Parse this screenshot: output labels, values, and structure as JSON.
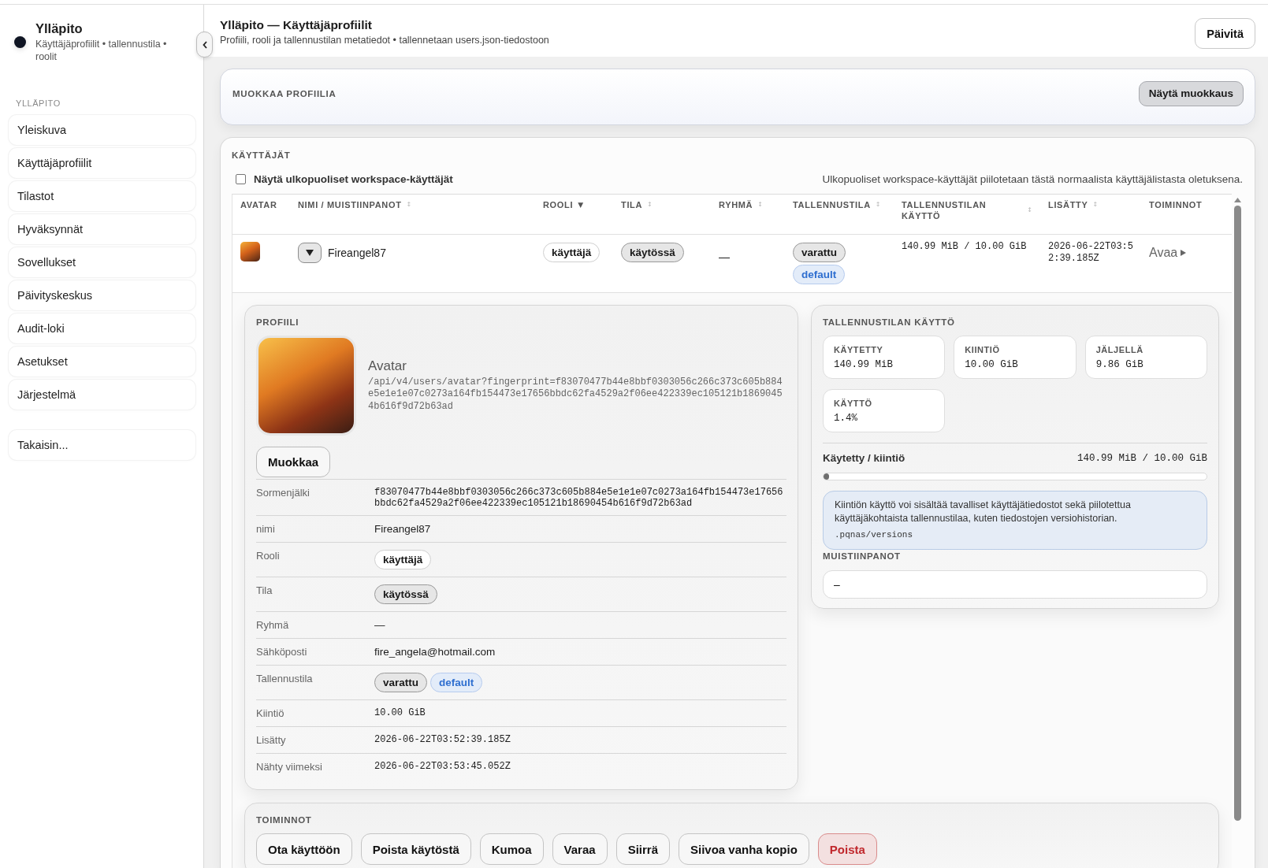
{
  "sidebar": {
    "brand": {
      "title": "Ylläpito",
      "subtitle": "Käyttäjäprofiilit • tallennustila • roolit"
    },
    "section_label": "YLLÄPITO",
    "items": [
      {
        "label": "Yleiskuva",
        "selected": false
      },
      {
        "label": "Käyttäjäprofiilit",
        "selected": false
      },
      {
        "label": "Tilastot",
        "selected": false
      },
      {
        "label": "Hyväksynnät",
        "selected": false
      },
      {
        "label": "Sovellukset",
        "selected": false
      },
      {
        "label": "Päivityskeskus",
        "selected": false
      },
      {
        "label": "Audit-loki",
        "selected": false
      },
      {
        "label": "Asetukset",
        "selected": false
      },
      {
        "label": "Järjestelmä",
        "selected": false
      }
    ],
    "back_item": {
      "label": "Takaisin..."
    }
  },
  "header": {
    "title": "Ylläpito — Käyttäjäprofiilit",
    "subtitle": "Profiili, rooli ja tallennustilan metatiedot • tallennetaan users.json-tiedostoon",
    "refresh_button": "Päivitä"
  },
  "edit_card": {
    "title": "MUOKKAA PROFIILIA",
    "toggle_button": "Näytä muokkaus"
  },
  "users": {
    "title": "KÄYTTÄJÄT",
    "external_filter": {
      "label": "Näytä ulkopuoliset workspace-käyttäjät",
      "checked": false
    },
    "note": "Ulkopuoliset workspace-käyttäjät piilotetaan tästä normaalista käyttäjälistasta oletuksena.",
    "table": {
      "columns": [
        {
          "label": "AVATAR"
        },
        {
          "label": "NIMI / MUISTIINPANOT",
          "sort_mark": "↕",
          "sorted": false
        },
        {
          "label": "ROOLI",
          "sort_mark": "▼",
          "sorted": true
        },
        {
          "label": "TILA",
          "sort_mark": "↕",
          "sorted": false
        },
        {
          "label": "RYHMÄ",
          "sort_mark": "↕",
          "sorted": false
        },
        {
          "label": "TALLENNUSTILA",
          "sort_mark": "↕",
          "sorted": false
        },
        {
          "label": "TALLENNUSTILAN KÄYTTÖ",
          "sort_mark": "↕",
          "sorted": false
        },
        {
          "label": "LISÄTTY",
          "sort_mark": "↕",
          "sorted": false
        },
        {
          "label": "TOIMINNOT"
        }
      ],
      "rows": [
        {
          "name": "Fireangel87",
          "expanded": true,
          "role": {
            "label": "käyttäjä",
            "kind": "outline"
          },
          "status": {
            "label": "käytössä",
            "kind": "neutral"
          },
          "group": "—",
          "storage": [
            {
              "label": "varattu",
              "kind": "neutral"
            },
            {
              "label": "default",
              "kind": "info"
            }
          ],
          "usage": "140.99 MiB / 10.00 GiB",
          "added": "2026-06-22T03:52:39.185Z",
          "action": "Avaa",
          "details": {
            "profile": {
              "title": "PROFIILI",
              "avatar_label": "Avatar",
              "avatar_url": "/api/v4/users/avatar?fingerprint=f83070477b44e8bbf0303056c266c373c605b884e5e1e1e07c0273a164fb154473e17656bbdc62fa4529a2f06ee422339ec105121b18690454b616f9d72b63ad",
              "edit_button": "Muokkaa",
              "fields": [
                {
                  "label": "Sormenjälki",
                  "kind": "mono",
                  "value": "f83070477b44e8bbf0303056c266c373c605b884e5e1e1e07c0273a164fb154473e17656bbdc62fa4529a2f06ee422339ec105121b18690454b616f9d72b63ad"
                },
                {
                  "label": "nimi",
                  "kind": "text",
                  "value": "Fireangel87"
                },
                {
                  "label": "Rooli",
                  "kind": "pills",
                  "pills": [
                    {
                      "label": "käyttäjä",
                      "kind": "outline"
                    }
                  ]
                },
                {
                  "label": "Tila",
                  "kind": "pills",
                  "pills": [
                    {
                      "label": "käytössä",
                      "kind": "neutral"
                    }
                  ]
                },
                {
                  "label": "Ryhmä",
                  "kind": "text",
                  "value": "—"
                },
                {
                  "label": "Sähköposti",
                  "kind": "text",
                  "value": "fire_angela@hotmail.com"
                },
                {
                  "label": "Tallennustila",
                  "kind": "pills",
                  "pills": [
                    {
                      "label": "varattu",
                      "kind": "neutral"
                    },
                    {
                      "label": "default",
                      "kind": "info"
                    }
                  ]
                },
                {
                  "label": "Kiintiö",
                  "kind": "mono",
                  "value": "10.00 GiB"
                },
                {
                  "label": "Lisätty",
                  "kind": "mono",
                  "value": "2026-06-22T03:52:39.185Z"
                },
                {
                  "label": "Nähty viimeksi",
                  "kind": "mono",
                  "value": "2026-06-22T03:53:45.052Z"
                }
              ]
            },
            "storage": {
              "title": "TALLENNUSTILAN KÄYTTÖ",
              "stats": [
                {
                  "label": "KÄYTETTY",
                  "value": "140.99 MiB"
                },
                {
                  "label": "KIINTIÖ",
                  "value": "10.00 GiB"
                },
                {
                  "label": "JÄLJELLÄ",
                  "value": "9.86 GiB"
                },
                {
                  "label": "KÄYTTÖ",
                  "value": "1.4%"
                }
              ],
              "quota_label": "Käytetty / kiintiö",
              "quota_reading": "140.99 MiB / 10.00 GiB",
              "level": 0.014,
              "info_text": "Kiintiön käyttö voi sisältää tavalliset käyttäjätiedostot sekä piilotettua käyttäjäkohtaista tallennustilaa, kuten tiedostojen versiohistorian.",
              "info_path": ".pqnas/versions",
              "notes_label": "MUISTIINPANOT",
              "notes_value": "–"
            },
            "actions": {
              "title": "TOIMINNOT",
              "buttons": [
                {
                  "label": "Ota käyttöön",
                  "kind": "default"
                },
                {
                  "label": "Poista käytöstä",
                  "kind": "default"
                },
                {
                  "label": "Kumoa",
                  "kind": "default"
                },
                {
                  "label": "Varaa",
                  "kind": "default"
                },
                {
                  "label": "Siirrä",
                  "kind": "default"
                },
                {
                  "label": "Siivoa vanha kopio",
                  "kind": "default"
                },
                {
                  "label": "Poista",
                  "kind": "danger"
                }
              ]
            }
          }
        }
      ]
    }
  }
}
